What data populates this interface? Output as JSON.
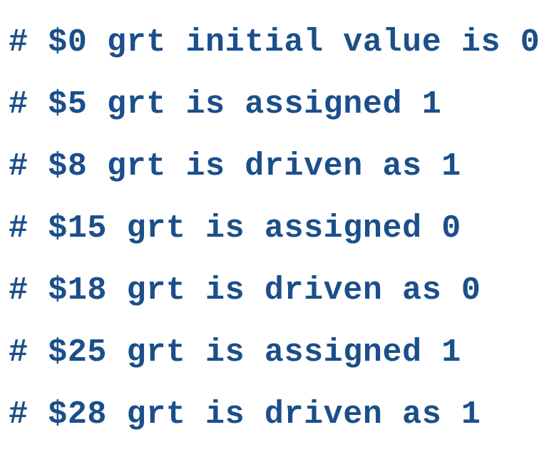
{
  "log": {
    "lines": [
      "# $0 grt initial value is 0",
      "# $5 grt is assigned 1",
      "# $8 grt is driven as 1",
      "# $15 grt is assigned 0",
      "# $18 grt is driven as 0",
      "# $25 grt is assigned 1",
      "# $28 grt is driven as 1"
    ]
  },
  "colors": {
    "text": "#1b4f8a",
    "background": "#ffffff"
  }
}
